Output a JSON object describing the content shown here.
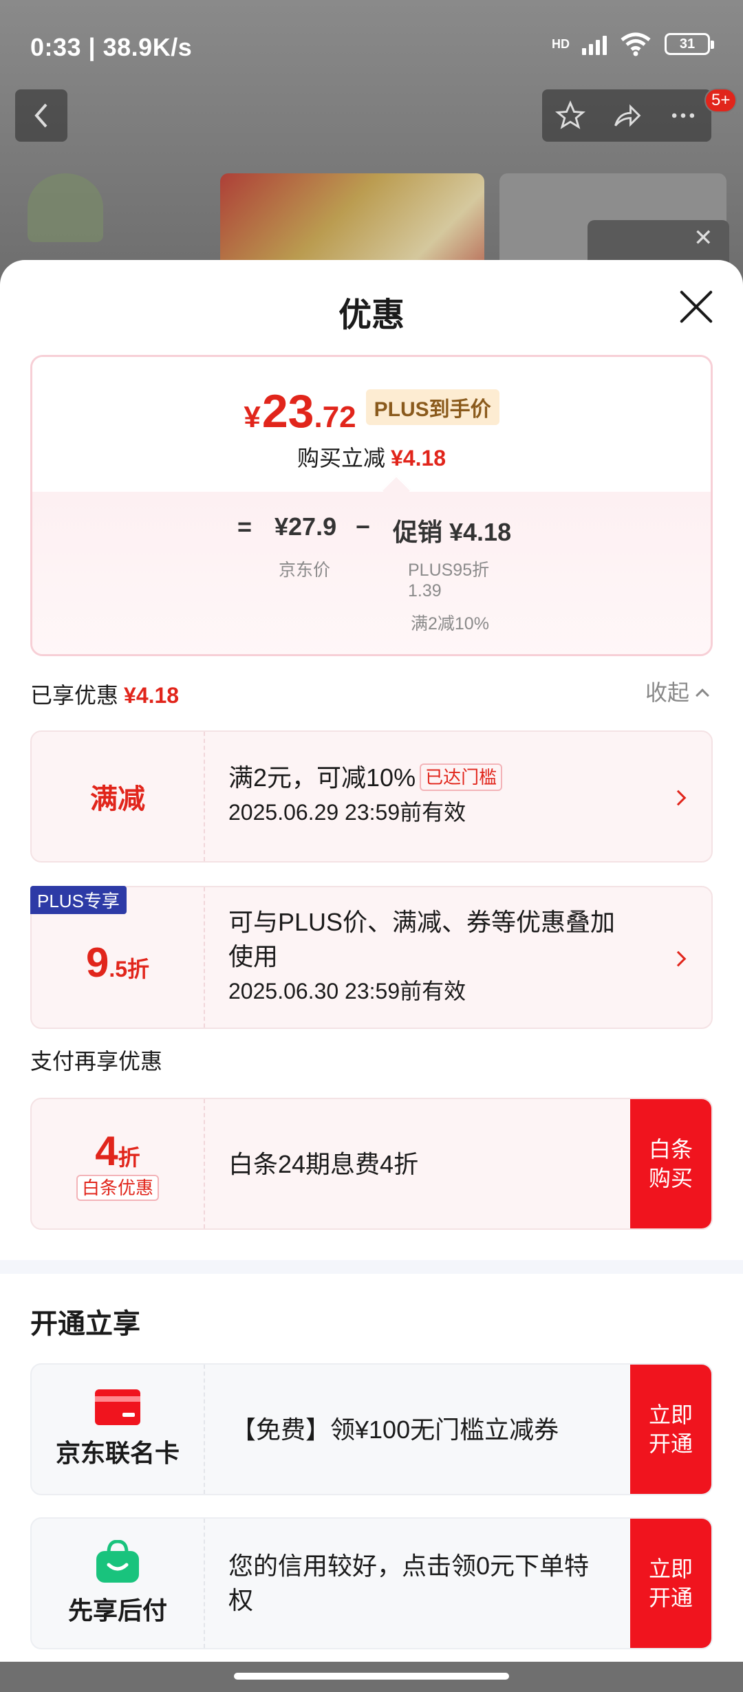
{
  "status_bar": {
    "time_speed": "0:33 | 38.9K/s",
    "battery": "31",
    "network": "HD"
  },
  "background": {
    "badge": "5+",
    "back_icon": "chevron-left-icon",
    "action_icons": [
      "star-icon",
      "share-icon",
      "more-icon"
    ]
  },
  "sheet": {
    "title": "优惠",
    "price": {
      "yen": "¥",
      "integer": "23",
      "decimal": ".72",
      "tag": "PLUS到手价",
      "reduce_label": "购买立减",
      "reduce_value": "¥4.18",
      "eq": "=",
      "base_price": "¥27.9",
      "minus": "−",
      "promo": "促销 ¥4.18",
      "base_label": "京东价",
      "promo_detail_1": "PLUS95折",
      "promo_detail_2": "1.39",
      "promo_detail_3": "满2减10%"
    },
    "enjoyed": {
      "label": "已享优惠",
      "value": "¥4.18",
      "collapse": "收起"
    },
    "coupons": [
      {
        "left": "满减",
        "line1": "满2元，可减10%",
        "tag": "已达门槛",
        "line2": "2025.06.29 23:59前有效"
      },
      {
        "corner": "PLUS专享",
        "left_big": "9",
        "left_small": ".5折",
        "line1": "可与PLUS价、满减、券等优惠叠加",
        "line1b": "使用",
        "line2": "2025.06.30 23:59前有效"
      }
    ],
    "pay_section": "支付再享优惠",
    "baitiao": {
      "big": "4",
      "small": "折",
      "tag": "白条优惠",
      "text": "白条24期息费4折",
      "button_l1": "白条",
      "button_l2": "购买"
    },
    "open_section": "开通立享",
    "open_items": [
      {
        "icon": "credit-card-icon",
        "label": "京东联名卡",
        "text": "【免费】领¥100无门槛立减券",
        "button_l1": "立即",
        "button_l2": "开通"
      },
      {
        "icon": "shopping-bag-icon",
        "label": "先享后付",
        "text1": "您的信用较好，点击领0元下单特",
        "text2": "权",
        "button_l1": "立即",
        "button_l2": "开通"
      }
    ]
  },
  "colors": {
    "accent": "#e1251b",
    "button": "#f0141e",
    "plus_blue": "#2d3aa6"
  }
}
